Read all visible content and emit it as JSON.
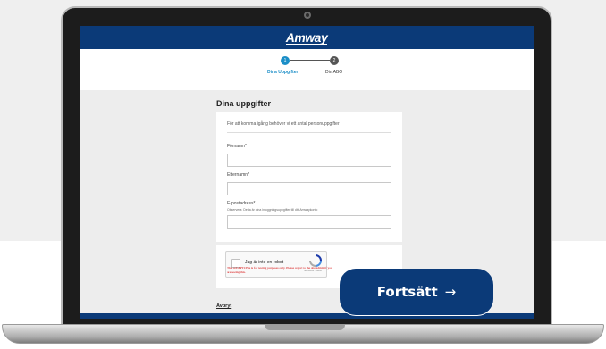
{
  "header": {
    "logo_text": "Amway"
  },
  "stepper": {
    "steps": [
      {
        "number": "1",
        "label": "Dina Uppgifter",
        "active": true
      },
      {
        "number": "2",
        "label": "Din ABO",
        "active": false
      }
    ]
  },
  "form": {
    "heading": "Dina uppgifter",
    "intro": "För att komma igång behöver vi ett antal personuppgifter",
    "fields": [
      {
        "label": "Förnamn*",
        "value": ""
      },
      {
        "label": "Efternamn*",
        "value": ""
      },
      {
        "label": "E-postadress*",
        "note": "Observera: Detta är dina inloggningsuppgifter till ditt Amwaykonto",
        "value": ""
      }
    ]
  },
  "captcha": {
    "label": "Jag är inte en robot",
    "terms": "Sekretess - Villkor",
    "warning": "This reCAPTCHA is for testing purposes only. Please report to the site admin if you are seeing this."
  },
  "actions": {
    "cancel_label": "Avbryt",
    "continue_label": "Fortsätt",
    "continue_arrow": "→"
  },
  "colors": {
    "brand_blue": "#0b3a78",
    "step_active": "#1b8ec7",
    "warning_red": "#d40000"
  }
}
